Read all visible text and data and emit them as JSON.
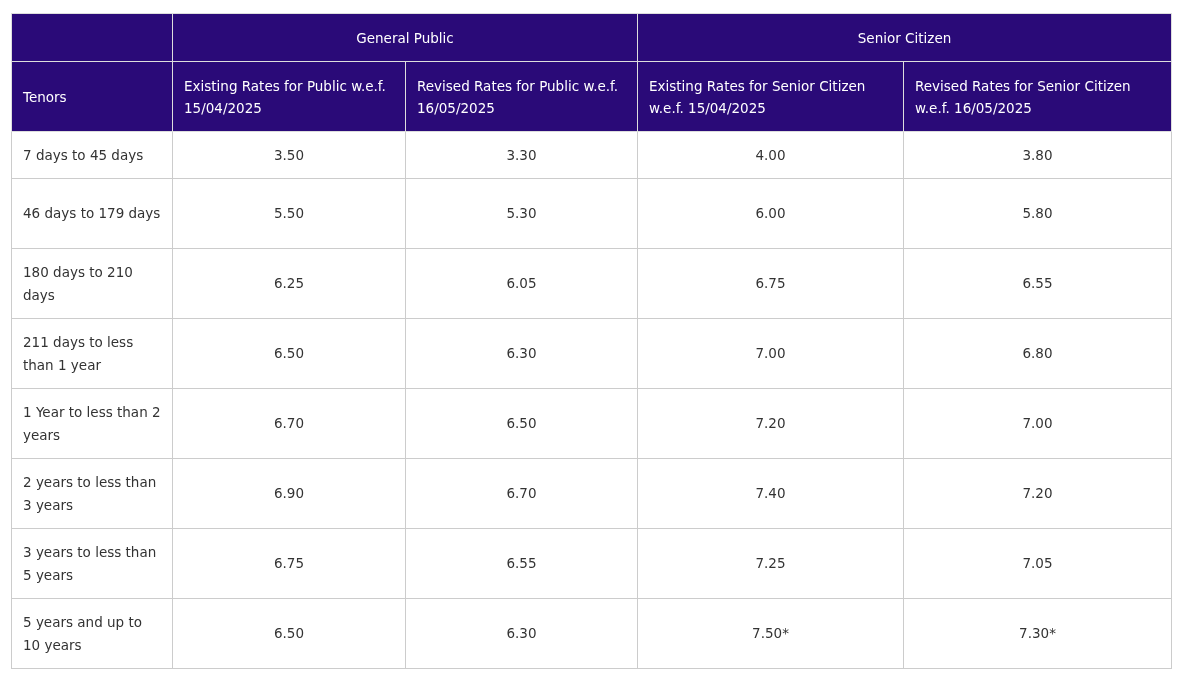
{
  "table": {
    "column_groups": [
      {
        "label": "General Public"
      },
      {
        "label": "Senior Citizen"
      }
    ],
    "columns": [
      "Tenors",
      "Existing Rates for Public w.e.f. 15/04/2025",
      "Revised Rates for Public w.e.f. 16/05/2025",
      "Existing Rates for Senior Citizen w.e.f. 15/04/2025",
      "Revised Rates for Senior Citizen w.e.f. 16/05/2025"
    ],
    "rows": [
      [
        "7 days to 45 days",
        "3.50",
        "3.30",
        "4.00",
        "3.80"
      ],
      [
        "46 days to 179 days",
        "5.50",
        "5.30",
        "6.00",
        "5.80"
      ],
      [
        "180 days to 210 days",
        "6.25",
        "6.05",
        "6.75",
        "6.55"
      ],
      [
        "211 days to less than 1 year",
        "6.50",
        "6.30",
        "7.00",
        "6.80"
      ],
      [
        "1 Year to less than 2 years",
        "6.70",
        "6.50",
        "7.20",
        "7.00"
      ],
      [
        "2 years to less than 3 years",
        "6.90",
        "6.70",
        "7.40",
        "7.20"
      ],
      [
        "3 years to less than 5 years",
        "6.75",
        "6.55",
        "7.25",
        "7.05"
      ],
      [
        "5 years and up to 10 years",
        "6.50",
        "6.30",
        "7.50*",
        "7.30*"
      ]
    ]
  }
}
